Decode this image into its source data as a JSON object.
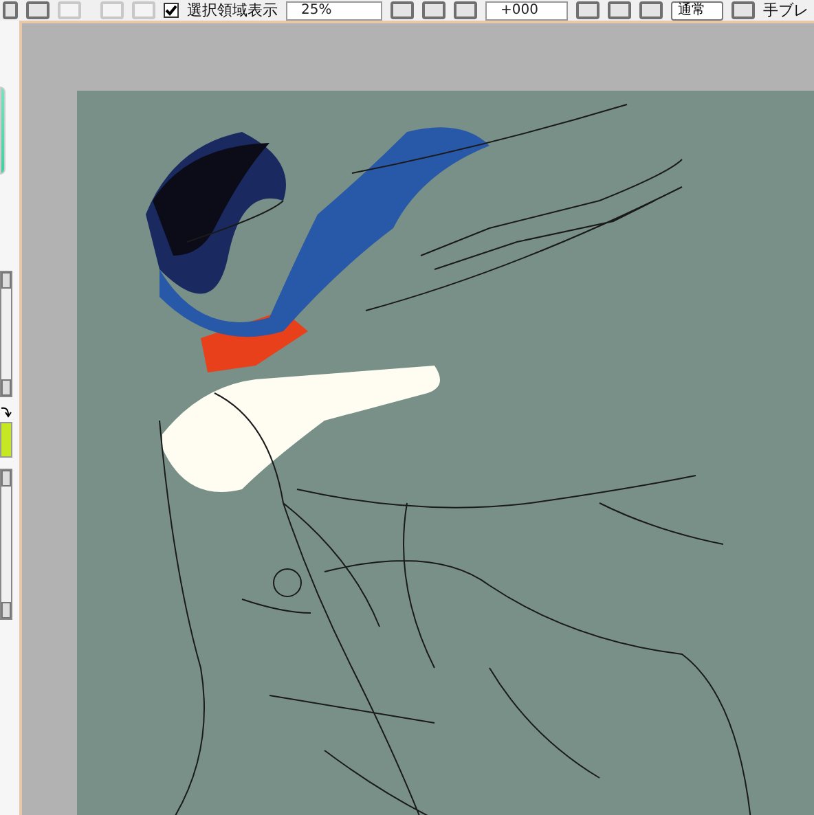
{
  "toolbar": {
    "selection_display": {
      "label": "選択領域表示",
      "checked": true
    },
    "zoom": "25%",
    "rotation": "+000",
    "blend_mode": "通常",
    "stabilizer_label": "手ブレ"
  }
}
